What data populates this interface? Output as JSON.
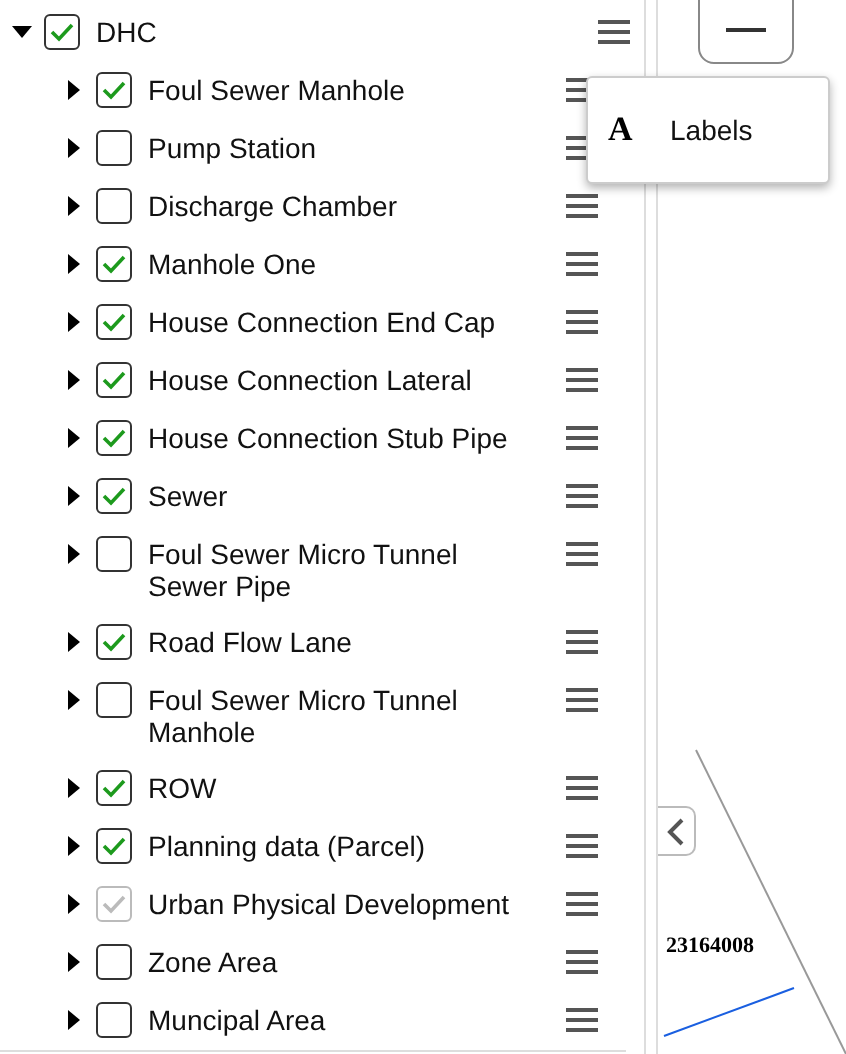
{
  "layer_tree": [
    {
      "label": "DHC",
      "checked": true,
      "disabled": false,
      "expanded": true,
      "children": [
        {
          "label": "Foul Sewer Manhole",
          "checked": true,
          "disabled": false,
          "expanded": false
        },
        {
          "label": "Pump Station",
          "checked": false,
          "disabled": false,
          "expanded": false
        },
        {
          "label": "Discharge Chamber",
          "checked": false,
          "disabled": false,
          "expanded": false
        },
        {
          "label": "Manhole One",
          "checked": true,
          "disabled": false,
          "expanded": false
        },
        {
          "label": "House Connection End Cap",
          "checked": true,
          "disabled": false,
          "expanded": false
        },
        {
          "label": "House Connection Lateral",
          "checked": true,
          "disabled": false,
          "expanded": false
        },
        {
          "label": "House Connection Stub Pipe",
          "checked": true,
          "disabled": false,
          "expanded": false
        },
        {
          "label": "Sewer",
          "checked": true,
          "disabled": false,
          "expanded": false
        },
        {
          "label": "Foul Sewer Micro Tunnel Sewer Pipe",
          "checked": false,
          "disabled": false,
          "expanded": false
        },
        {
          "label": "Road Flow Lane",
          "checked": true,
          "disabled": false,
          "expanded": false
        },
        {
          "label": "Foul Sewer Micro Tunnel Manhole",
          "checked": false,
          "disabled": false,
          "expanded": false
        },
        {
          "label": "ROW",
          "checked": true,
          "disabled": false,
          "expanded": false
        },
        {
          "label": "Planning data (Parcel)",
          "checked": true,
          "disabled": false,
          "expanded": false
        },
        {
          "label": "Urban Physical Development",
          "checked": true,
          "disabled": true,
          "expanded": false
        },
        {
          "label": "Zone Area",
          "checked": false,
          "disabled": false,
          "expanded": false
        },
        {
          "label": "Muncipal Area",
          "checked": false,
          "disabled": false,
          "expanded": false
        }
      ]
    }
  ],
  "layer_menu": {
    "items": [
      {
        "icon": "A",
        "label": "Labels"
      }
    ]
  },
  "map": {
    "parcel_label": "23164008"
  }
}
